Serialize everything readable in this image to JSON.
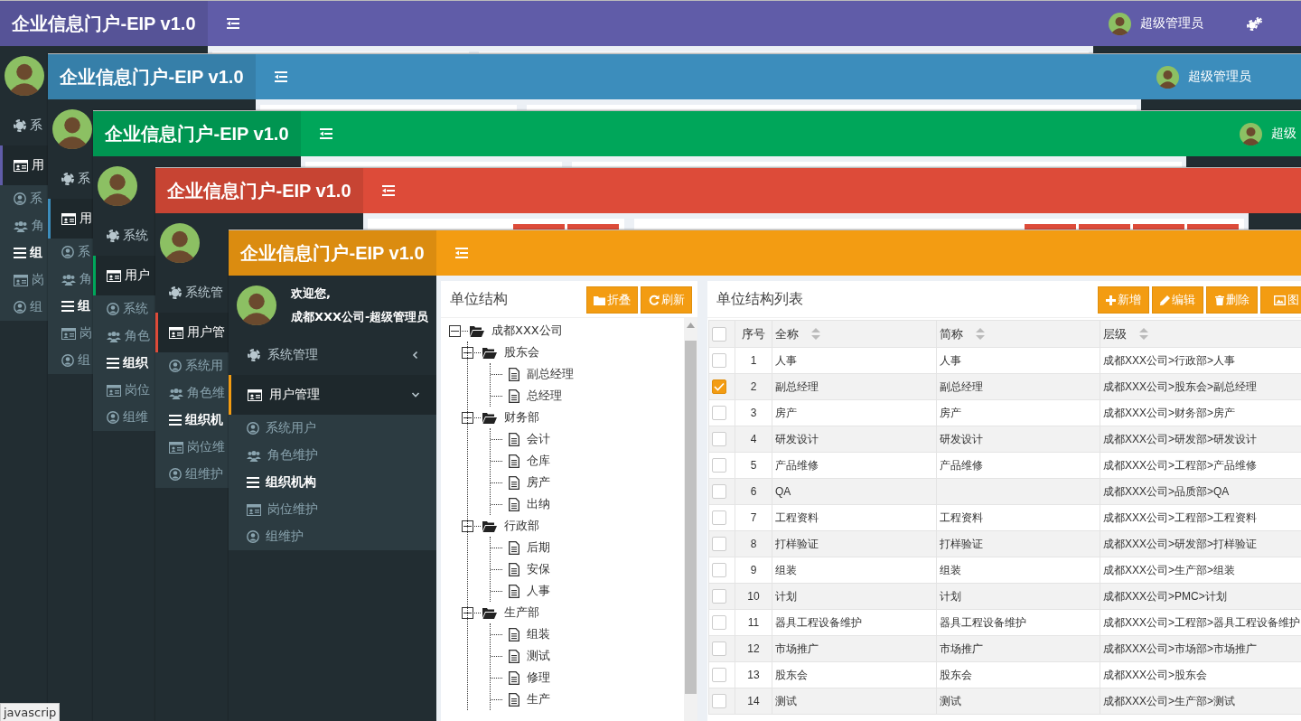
{
  "windows": [
    {
      "color": "#605ca8",
      "title": "企业信息门户-EIP v1.0",
      "user_name": "超级管理员",
      "settings_button": true,
      "menu": [
        {
          "label": "系",
          "selected": false
        },
        {
          "label": "用",
          "selected": true,
          "expanded": true,
          "children": [
            {
              "label": "系",
              "selected": false
            },
            {
              "label": "角",
              "selected": false
            },
            {
              "label": "组",
              "selected": true
            },
            {
              "label": "岗",
              "selected": false
            },
            {
              "label": "组",
              "selected": false
            }
          ]
        }
      ]
    },
    {
      "color": "#3c8dbc",
      "title": "企业信息门户-EIP v1.0",
      "user_name": "超级管理员",
      "menu": [
        {
          "label": "系",
          "selected": false
        },
        {
          "label": "用",
          "selected": true,
          "expanded": true,
          "children": [
            {
              "label": "系",
              "selected": false
            },
            {
              "label": "角",
              "selected": false
            },
            {
              "label": "组",
              "selected": true
            },
            {
              "label": "岗",
              "selected": false
            },
            {
              "label": "组",
              "selected": false
            }
          ]
        }
      ]
    },
    {
      "color": "#00a65a",
      "title": "企业信息门户-EIP v1.0",
      "user_name": "超级",
      "menu": [
        {
          "label": "系统",
          "selected": false
        },
        {
          "label": "用户",
          "selected": true,
          "expanded": true,
          "children": [
            {
              "label": "系统",
              "selected": false
            },
            {
              "label": "角色",
              "selected": false
            },
            {
              "label": "组织",
              "selected": true
            },
            {
              "label": "岗位",
              "selected": false
            },
            {
              "label": "组维",
              "selected": false
            }
          ]
        }
      ]
    },
    {
      "color": "#dd4b39",
      "title": "企业信息门户-EIP v1.0",
      "menu": [
        {
          "label": "系统管",
          "selected": false
        },
        {
          "label": "用户管",
          "selected": true,
          "expanded": true,
          "children": [
            {
              "label": "系统用",
              "selected": false
            },
            {
              "label": "角色维",
              "selected": false
            },
            {
              "label": "组织机",
              "selected": true
            },
            {
              "label": "岗位维",
              "selected": false
            },
            {
              "label": "组维护",
              "selected": false
            }
          ]
        }
      ]
    },
    {
      "color": "#f39c12",
      "title": "企业信息门户-EIP v1.0",
      "welcome": "欢迎您,",
      "account": "成都XXX公司-超级管理员",
      "menu": [
        {
          "label": "系统管理",
          "selected": false,
          "expanded": false
        },
        {
          "label": "用户管理",
          "selected": true,
          "expanded": true,
          "children": [
            {
              "label": "系统用户",
              "selected": false
            },
            {
              "label": "角色维护",
              "selected": false
            },
            {
              "label": "组织机构",
              "selected": true
            },
            {
              "label": "岗位维护",
              "selected": false
            },
            {
              "label": "组维护",
              "selected": false
            }
          ]
        }
      ],
      "tree_panel": {
        "title": "单位结构",
        "buttons": [
          "折叠",
          "刷新"
        ],
        "tree": [
          {
            "kind": "folder",
            "label": "成都XXX公司",
            "expanded": true,
            "children": [
              {
                "kind": "folder",
                "label": "股东会",
                "expanded": true,
                "children": [
                  {
                    "kind": "file",
                    "label": "副总经理"
                  },
                  {
                    "kind": "file",
                    "label": "总经理"
                  }
                ]
              },
              {
                "kind": "folder",
                "label": "财务部",
                "expanded": true,
                "children": [
                  {
                    "kind": "file",
                    "label": "会计"
                  },
                  {
                    "kind": "file",
                    "label": "仓库"
                  },
                  {
                    "kind": "file",
                    "label": "房产"
                  },
                  {
                    "kind": "file",
                    "label": "出纳"
                  }
                ]
              },
              {
                "kind": "folder",
                "label": "行政部",
                "expanded": true,
                "children": [
                  {
                    "kind": "file",
                    "label": "后期"
                  },
                  {
                    "kind": "file",
                    "label": "安保"
                  },
                  {
                    "kind": "file",
                    "label": "人事"
                  }
                ]
              },
              {
                "kind": "folder",
                "label": "生产部",
                "expanded": true,
                "children": [
                  {
                    "kind": "file",
                    "label": "组装"
                  },
                  {
                    "kind": "file",
                    "label": "测试"
                  },
                  {
                    "kind": "file",
                    "label": "修理"
                  },
                  {
                    "kind": "file",
                    "label": "生产"
                  }
                ]
              }
            ]
          }
        ]
      },
      "list_panel": {
        "title": "单位结构列表",
        "buttons": [
          "新增",
          "编辑",
          "删除",
          "图"
        ],
        "table": {
          "select_all_checked": false,
          "columns": [
            {
              "label": "序号",
              "sortable": false
            },
            {
              "label": "全称",
              "sortable": true
            },
            {
              "label": "简称",
              "sortable": true
            },
            {
              "label": "层级",
              "sortable": true
            }
          ],
          "rows": [
            {
              "checked": false,
              "cells": [
                "1",
                "人事",
                "人事",
                "成都XXX公司>行政部>人事"
              ]
            },
            {
              "checked": true,
              "cells": [
                "2",
                "副总经理",
                "副总经理",
                "成都XXX公司>股东会>副总经理"
              ]
            },
            {
              "checked": false,
              "cells": [
                "3",
                "房产",
                "房产",
                "成都XXX公司>财务部>房产"
              ]
            },
            {
              "checked": false,
              "cells": [
                "4",
                "研发设计",
                "研发设计",
                "成都XXX公司>研发部>研发设计"
              ]
            },
            {
              "checked": false,
              "cells": [
                "5",
                "产品维修",
                "产品维修",
                "成都XXX公司>工程部>产品维修"
              ]
            },
            {
              "checked": false,
              "cells": [
                "6",
                "QA",
                "",
                "成都XXX公司>品质部>QA"
              ]
            },
            {
              "checked": false,
              "cells": [
                "7",
                "工程资料",
                "工程资料",
                "成都XXX公司>工程部>工程资料"
              ]
            },
            {
              "checked": false,
              "cells": [
                "8",
                "打样验证",
                "打样验证",
                "成都XXX公司>研发部>打样验证"
              ]
            },
            {
              "checked": false,
              "cells": [
                "9",
                "组装",
                "组装",
                "成都XXX公司>生产部>组装"
              ]
            },
            {
              "checked": false,
              "cells": [
                "10",
                "计划",
                "计划",
                "成都XXX公司>PMC>计划"
              ]
            },
            {
              "checked": false,
              "cells": [
                "11",
                "器具工程设备维护",
                "器具工程设备维护",
                "成都XXX公司>工程部>器具工程设备维护"
              ]
            },
            {
              "checked": false,
              "cells": [
                "12",
                "市场推广",
                "市场推广",
                "成都XXX公司>市场部>市场推广"
              ]
            },
            {
              "checked": false,
              "cells": [
                "13",
                "股东会",
                "股东会",
                "成都XXX公司>股东会"
              ]
            },
            {
              "checked": false,
              "cells": [
                "14",
                "测试",
                "测试",
                "成都XXX公司>生产部>测试"
              ]
            }
          ]
        }
      }
    }
  ],
  "status_bar": {
    "text": "javascrip"
  }
}
